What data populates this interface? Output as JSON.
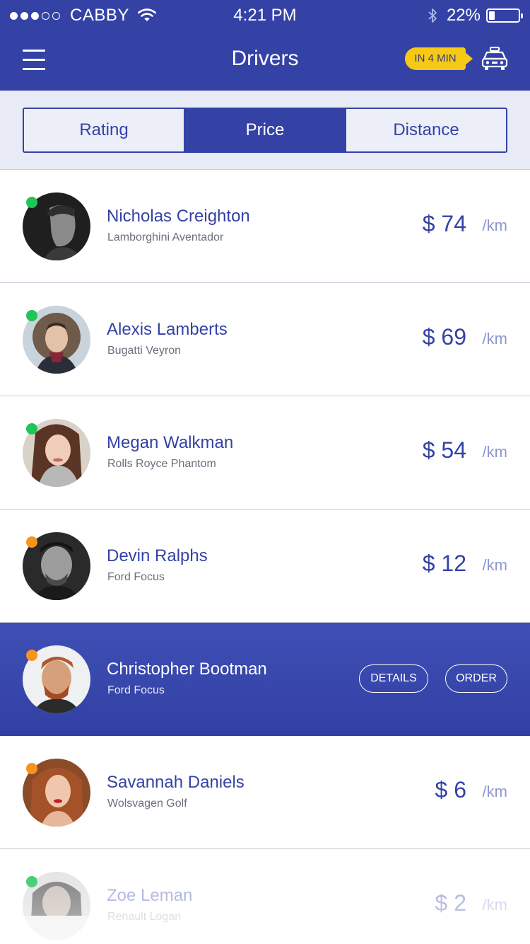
{
  "status_bar": {
    "carrier": "CABBY",
    "time": "4:21 PM",
    "battery": "22%"
  },
  "header": {
    "title": "Drivers",
    "eta_badge": "IN 4 MIN"
  },
  "sort_tabs": {
    "rating": "Rating",
    "price": "Price",
    "distance": "Distance",
    "active": "Price"
  },
  "colors": {
    "brand": "#3442a6",
    "badge": "#f6c915",
    "online": "#20c558",
    "busy": "#f7941d"
  },
  "drivers": [
    {
      "name": "Nicholas Creighton",
      "car": "Lamborghini Aventador",
      "price": "$ 74",
      "unit": "/km",
      "status": "online"
    },
    {
      "name": "Alexis Lamberts",
      "car": "Bugatti Veyron",
      "price": "$ 69",
      "unit": "/km",
      "status": "online"
    },
    {
      "name": "Megan Walkman",
      "car": "Rolls Royce Phantom",
      "price": "$ 54",
      "unit": "/km",
      "status": "online"
    },
    {
      "name": "Devin Ralphs",
      "car": "Ford Focus",
      "price": "$ 12",
      "unit": "/km",
      "status": "busy"
    },
    {
      "name": "Christopher Bootman",
      "car": "Ford Focus",
      "details_label": "DETAILS",
      "order_label": "ORDER",
      "status": "busy"
    },
    {
      "name": "Savannah Daniels",
      "car": "Wolsvagen Golf",
      "price": "$ 6",
      "unit": "/km",
      "status": "busy"
    },
    {
      "name": "Zoe Leman",
      "car": "Renault Logan",
      "price": "$ 2",
      "unit": "/km",
      "status": "online"
    }
  ]
}
